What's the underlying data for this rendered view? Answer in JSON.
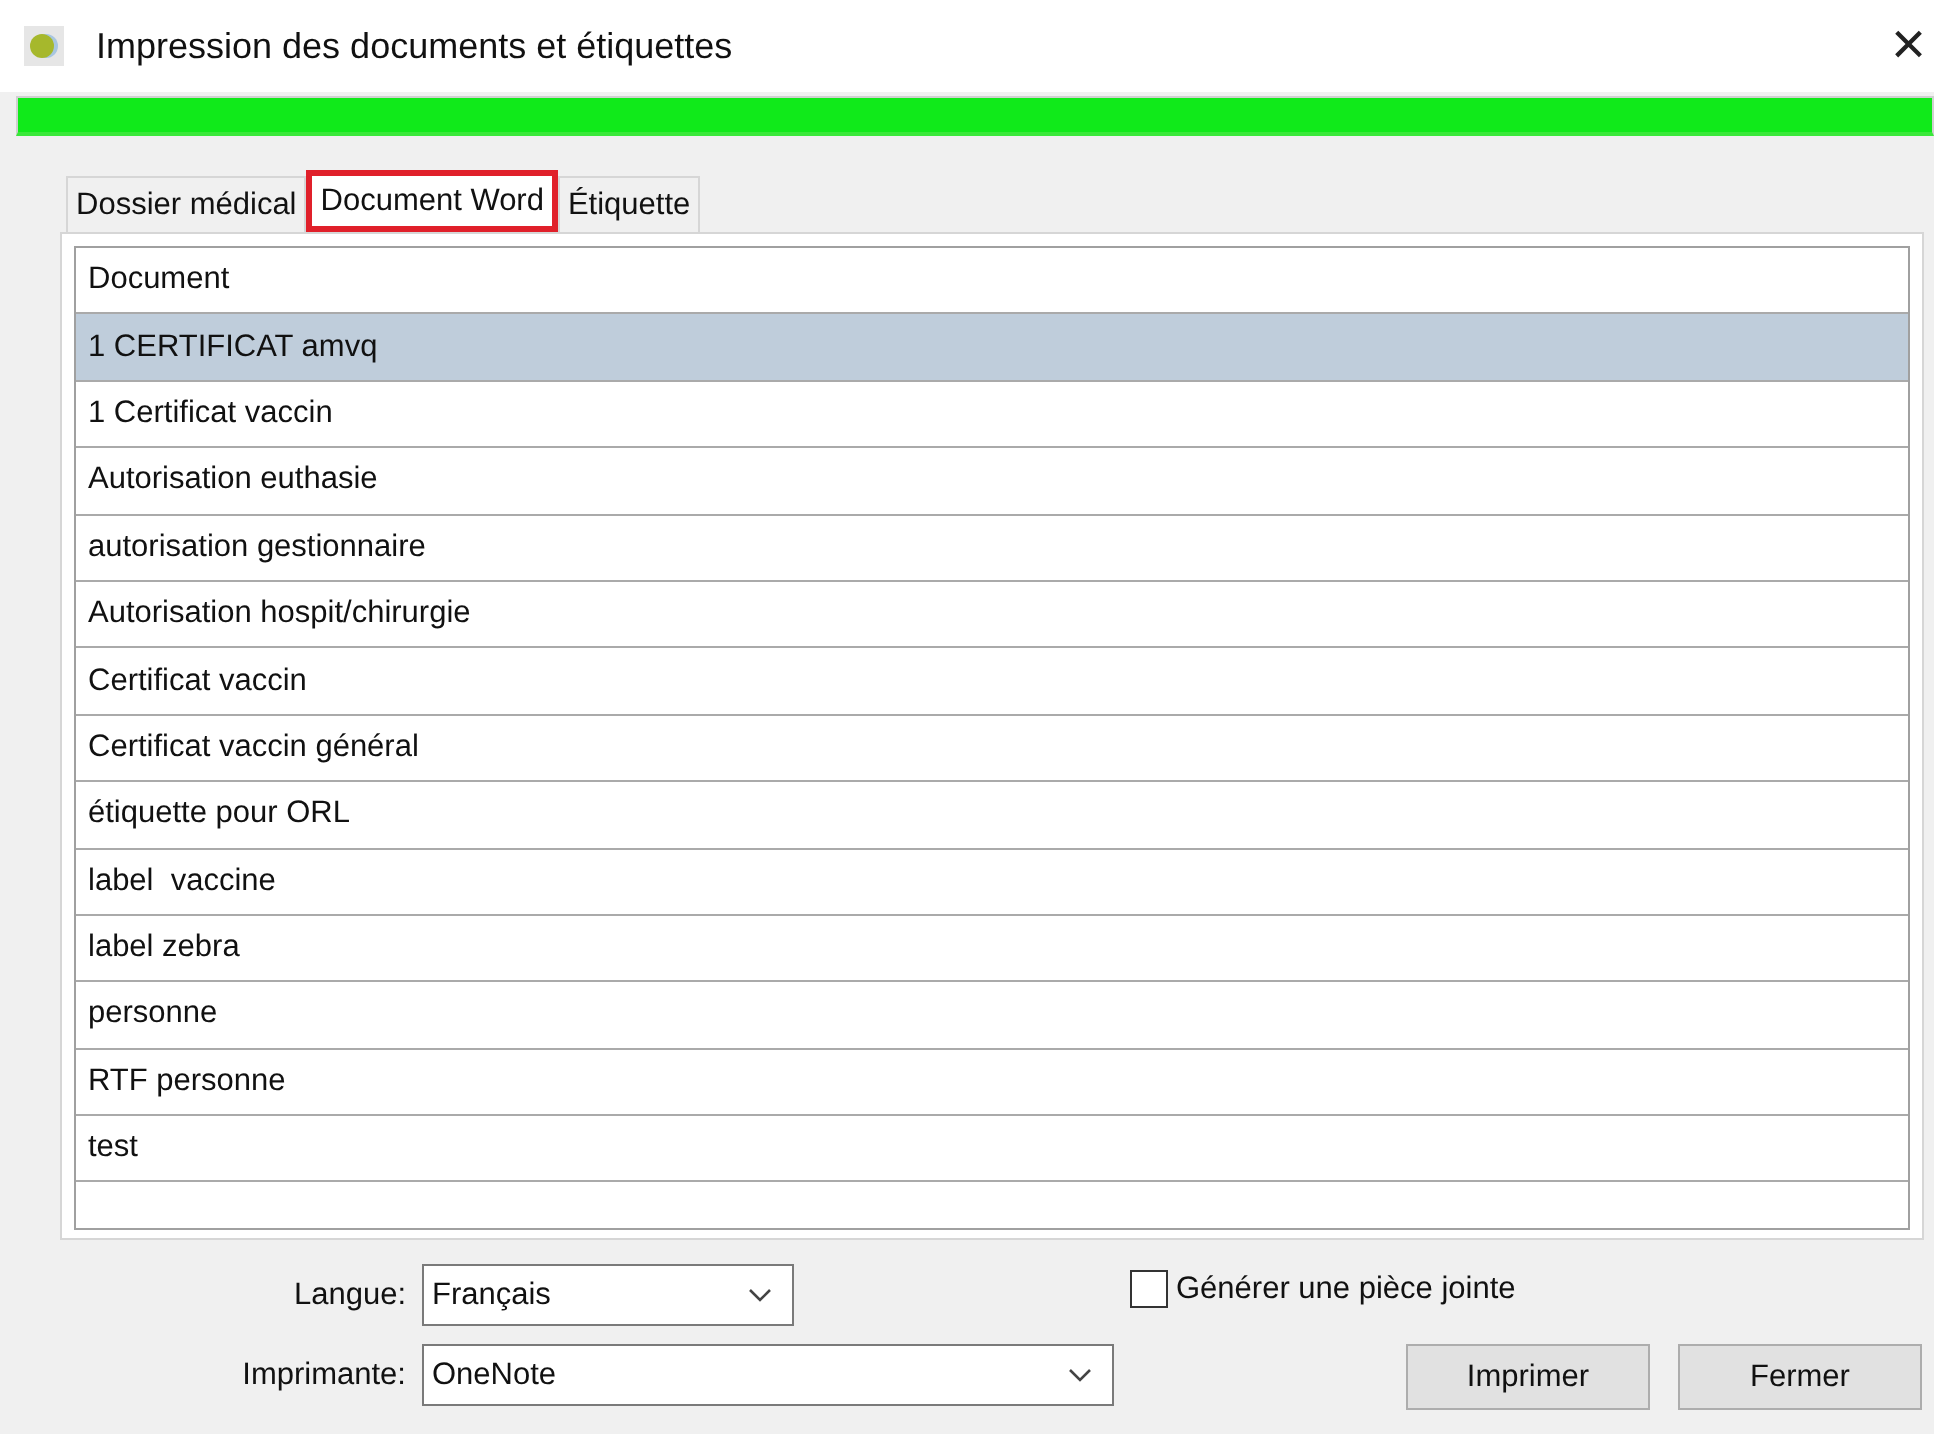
{
  "window": {
    "title": "Impression des documents et étiquettes",
    "close": "×"
  },
  "progress": {
    "level": 1
  },
  "tabs": [
    {
      "label": "Dossier médical",
      "selected": false,
      "highlighted": false
    },
    {
      "label": "Document Word",
      "selected": true,
      "highlighted": true
    },
    {
      "label": "Étiquette",
      "selected": false,
      "highlighted": false
    }
  ],
  "table": {
    "columns": [
      "Document"
    ],
    "rows": [
      {
        "cells": [
          "1 CERTIFICAT amvq"
        ],
        "selected": true
      },
      {
        "cells": [
          "1 Certificat vaccin"
        ],
        "selected": false
      },
      {
        "cells": [
          "Autorisation euthasie"
        ],
        "selected": false
      },
      {
        "cells": [
          "autorisation gestionnaire"
        ],
        "selected": false
      },
      {
        "cells": [
          "Autorisation hospit/chirurgie"
        ],
        "selected": false
      },
      {
        "cells": [
          "Certificat vaccin"
        ],
        "selected": false
      },
      {
        "cells": [
          "Certificat vaccin général"
        ],
        "selected": false
      },
      {
        "cells": [
          "étiquette pour ORL"
        ],
        "selected": false
      },
      {
        "cells": [
          "label  vaccine"
        ],
        "selected": false
      },
      {
        "cells": [
          "label zebra"
        ],
        "selected": false
      },
      {
        "cells": [
          "personne"
        ],
        "selected": false
      },
      {
        "cells": [
          "RTF personne"
        ],
        "selected": false
      },
      {
        "cells": [
          "test"
        ],
        "selected": false
      }
    ]
  },
  "language": {
    "label": "Langue:",
    "value": "Français"
  },
  "printer": {
    "label": "Imprimante:",
    "value": "OneNote"
  },
  "attachment": {
    "label": "Générer une pièce jointe",
    "checked": false
  },
  "buttons": [
    "Imprimer",
    "Fermer"
  ]
}
